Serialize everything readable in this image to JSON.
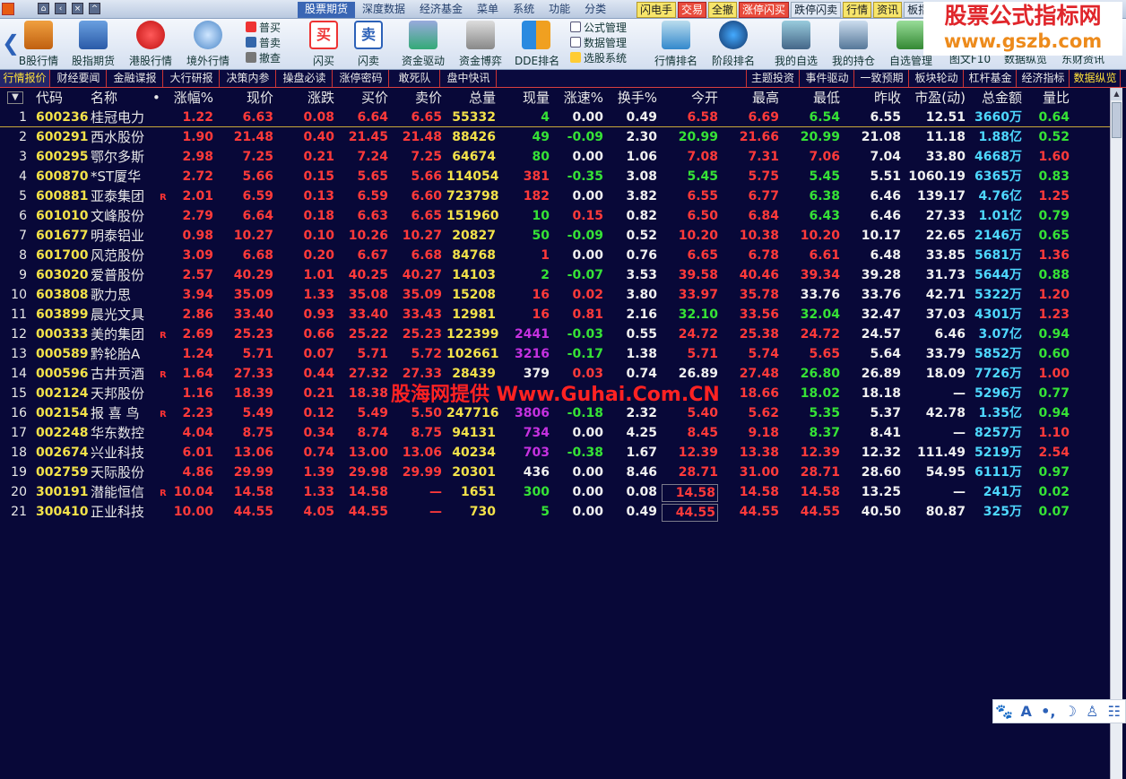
{
  "menubar": {
    "menus": [
      "股票期货",
      "深度数据",
      "经济基金",
      "菜单",
      "系统",
      "功能",
      "分类"
    ],
    "quick": [
      "闪电手",
      "交易",
      "全撤",
      "涨停闪买",
      "跌停闪卖",
      "行情",
      "资讯",
      "板指"
    ]
  },
  "logo": {
    "line1": "股票公式指标网",
    "line2": "www.gszb.com"
  },
  "toolbar": {
    "buttons": [
      "B股行情",
      "股指期货",
      "港股行情",
      "境外行情",
      "闪买",
      "闪卖",
      "资金驱动",
      "资金博弈",
      "DDE排名",
      "行情排名",
      "阶段排名",
      "我的自选",
      "我的持仓",
      "自选管理"
    ],
    "trade_stack": [
      "普买",
      "普卖",
      "撤查"
    ],
    "formula_stack": [
      "公式管理",
      "数据管理",
      "选股系统"
    ],
    "right_labels": [
      "图文F10",
      "数据纵览",
      "东财资讯"
    ]
  },
  "tabs": {
    "left": [
      "行情报价",
      "财经要闻",
      "金融谍报",
      "大行研报",
      "决策内参",
      "操盘必读",
      "涨停密码",
      "敢死队",
      "盘中快讯"
    ],
    "right": [
      "主题投资",
      "事件驱动",
      "一致预期",
      "板块轮动",
      "杠杆基金",
      "经济指标",
      "数据纵览"
    ]
  },
  "table": {
    "headers": [
      "代码",
      "名称",
      "•",
      "涨幅%",
      "现价",
      "涨跌",
      "买价",
      "卖价",
      "总量",
      "现量",
      "涨速%",
      "换手%",
      "今开",
      "最高",
      "最低",
      "昨收",
      "市盈(动)",
      "总金额",
      "量比"
    ],
    "rows": [
      [
        "1",
        "600236",
        "桂冠电力",
        "",
        "1.22",
        "6.63",
        "0.08",
        "6.64",
        "6.65",
        "55332",
        "4",
        "0.00",
        "0.49",
        "6.58",
        "6.69",
        "6.54",
        "6.55",
        "12.51",
        "3660万",
        "0.64"
      ],
      [
        "2",
        "600291",
        "西水股份",
        "",
        "1.90",
        "21.48",
        "0.40",
        "21.45",
        "21.48",
        "88426",
        "49",
        "-0.09",
        "2.30",
        "20.99",
        "21.66",
        "20.99",
        "21.08",
        "11.18",
        "1.88亿",
        "0.52"
      ],
      [
        "3",
        "600295",
        "鄂尔多斯",
        "",
        "2.98",
        "7.25",
        "0.21",
        "7.24",
        "7.25",
        "64674",
        "80",
        "0.00",
        "1.06",
        "7.08",
        "7.31",
        "7.06",
        "7.04",
        "33.80",
        "4668万",
        "1.60"
      ],
      [
        "4",
        "600870",
        "*ST厦华",
        "",
        "2.72",
        "5.66",
        "0.15",
        "5.65",
        "5.66",
        "114054",
        "381",
        "-0.35",
        "3.08",
        "5.45",
        "5.75",
        "5.45",
        "5.51",
        "1060.19",
        "6365万",
        "0.83"
      ],
      [
        "5",
        "600881",
        "亚泰集团",
        "R",
        "2.01",
        "6.59",
        "0.13",
        "6.59",
        "6.60",
        "723798",
        "182",
        "0.00",
        "3.82",
        "6.55",
        "6.77",
        "6.38",
        "6.46",
        "139.17",
        "4.76亿",
        "1.25"
      ],
      [
        "6",
        "601010",
        "文峰股份",
        "",
        "2.79",
        "6.64",
        "0.18",
        "6.63",
        "6.65",
        "151960",
        "10",
        "0.15",
        "0.82",
        "6.50",
        "6.84",
        "6.43",
        "6.46",
        "27.33",
        "1.01亿",
        "0.79"
      ],
      [
        "7",
        "601677",
        "明泰铝业",
        "",
        "0.98",
        "10.27",
        "0.10",
        "10.26",
        "10.27",
        "20827",
        "50",
        "-0.09",
        "0.52",
        "10.20",
        "10.38",
        "10.20",
        "10.17",
        "22.65",
        "2146万",
        "0.65"
      ],
      [
        "8",
        "601700",
        "风范股份",
        "",
        "3.09",
        "6.68",
        "0.20",
        "6.67",
        "6.68",
        "84768",
        "1",
        "0.00",
        "0.76",
        "6.65",
        "6.78",
        "6.61",
        "6.48",
        "33.85",
        "5681万",
        "1.36"
      ],
      [
        "9",
        "603020",
        "爱普股份",
        "",
        "2.57",
        "40.29",
        "1.01",
        "40.25",
        "40.27",
        "14103",
        "2",
        "-0.07",
        "3.53",
        "39.58",
        "40.46",
        "39.34",
        "39.28",
        "31.73",
        "5644万",
        "0.88"
      ],
      [
        "10",
        "603808",
        "歌力思",
        "",
        "3.94",
        "35.09",
        "1.33",
        "35.08",
        "35.09",
        "15208",
        "16",
        "0.02",
        "3.80",
        "33.97",
        "35.78",
        "33.76",
        "33.76",
        "42.71",
        "5322万",
        "1.20"
      ],
      [
        "11",
        "603899",
        "晨光文具",
        "",
        "2.86",
        "33.40",
        "0.93",
        "33.40",
        "33.43",
        "12981",
        "16",
        "0.81",
        "2.16",
        "32.10",
        "33.56",
        "32.04",
        "32.47",
        "37.03",
        "4301万",
        "1.23"
      ],
      [
        "12",
        "000333",
        "美的集团",
        "R",
        "2.69",
        "25.23",
        "0.66",
        "25.22",
        "25.23",
        "122399",
        "2441",
        "-0.03",
        "0.55",
        "24.72",
        "25.38",
        "24.72",
        "24.57",
        "6.46",
        "3.07亿",
        "0.94"
      ],
      [
        "13",
        "000589",
        "黔轮胎A",
        "",
        "1.24",
        "5.71",
        "0.07",
        "5.71",
        "5.72",
        "102661",
        "3216",
        "-0.17",
        "1.38",
        "5.71",
        "5.74",
        "5.65",
        "5.64",
        "33.79",
        "5852万",
        "0.60"
      ],
      [
        "14",
        "000596",
        "古井贡酒",
        "R",
        "1.64",
        "27.33",
        "0.44",
        "27.32",
        "27.33",
        "28439",
        "379",
        "0.03",
        "0.74",
        "26.89",
        "27.48",
        "26.80",
        "26.89",
        "18.09",
        "7726万",
        "1.00"
      ],
      [
        "15",
        "002124",
        "天邦股份",
        "",
        "1.16",
        "18.39",
        "0.21",
        "18.38",
        "",
        "",
        "",
        "",
        "",
        "",
        "18.66",
        "18.02",
        "18.18",
        "—",
        "5296万",
        "0.77"
      ],
      [
        "16",
        "002154",
        "报 喜 鸟",
        "R",
        "2.23",
        "5.49",
        "0.12",
        "5.49",
        "5.50",
        "247716",
        "3806",
        "-0.18",
        "2.32",
        "5.40",
        "5.62",
        "5.35",
        "5.37",
        "42.78",
        "1.35亿",
        "0.94"
      ],
      [
        "17",
        "002248",
        "华东数控",
        "",
        "4.04",
        "8.75",
        "0.34",
        "8.74",
        "8.75",
        "94131",
        "734",
        "0.00",
        "4.25",
        "8.45",
        "9.18",
        "8.37",
        "8.41",
        "—",
        "8257万",
        "1.10"
      ],
      [
        "18",
        "002674",
        "兴业科技",
        "",
        "6.01",
        "13.06",
        "0.74",
        "13.00",
        "13.06",
        "40234",
        "703",
        "-0.38",
        "1.67",
        "12.39",
        "13.38",
        "12.39",
        "12.32",
        "111.49",
        "5219万",
        "2.54"
      ],
      [
        "19",
        "002759",
        "天际股份",
        "",
        "4.86",
        "29.99",
        "1.39",
        "29.98",
        "29.99",
        "20301",
        "436",
        "0.00",
        "8.46",
        "28.71",
        "31.00",
        "28.71",
        "28.60",
        "54.95",
        "6111万",
        "0.97"
      ],
      [
        "20",
        "300191",
        "潜能恒信",
        "R",
        "10.04",
        "14.58",
        "1.33",
        "14.58",
        "—",
        "1651",
        "300",
        "0.00",
        "0.08",
        "14.58",
        "14.58",
        "14.58",
        "13.25",
        "—",
        "241万",
        "0.02"
      ],
      [
        "21",
        "300410",
        "正业科技",
        "",
        "10.00",
        "44.55",
        "4.05",
        "44.55",
        "—",
        "730",
        "5",
        "0.00",
        "0.49",
        "44.55",
        "44.55",
        "44.55",
        "40.50",
        "80.87",
        "325万",
        "0.07"
      ]
    ]
  },
  "watermark": "股海网提供 Www.Guhai.Com.CN",
  "ime": [
    "🐾",
    "A",
    "•,",
    "☽",
    "♙",
    "☷"
  ]
}
